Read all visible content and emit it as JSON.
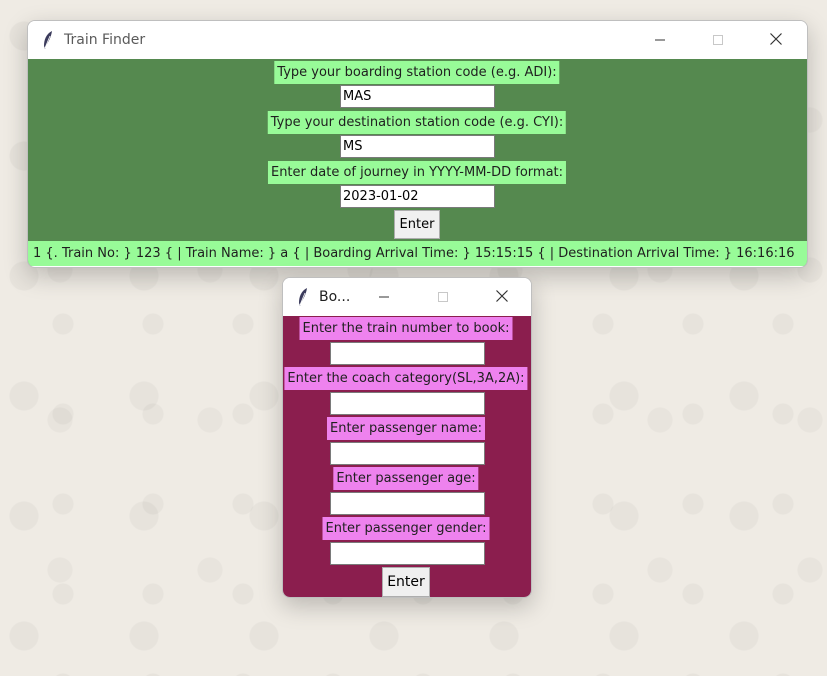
{
  "train_finder": {
    "title": "Train Finder",
    "boarding_label": "Type your boarding station code (e.g. ADI):",
    "boarding_value": "MAS",
    "destination_label": "Type your destination station code (e.g. CYI):",
    "destination_value": "MS",
    "date_label": "Enter date of journey in YYYY-MM-DD format:",
    "date_value": "2023-01-02",
    "enter_label": "Enter",
    "result_text": "1 {. Train No: } 123 { | Train Name: } a { | Boarding Arrival Time: } 15:15:15 { | Destination Arrival Time: } 16:16:16"
  },
  "booking": {
    "title": "Bo...",
    "train_number_label": "Enter the train number to book:",
    "train_number_value": "",
    "coach_label": "Enter the coach category(SL,3A,2A):",
    "coach_value": "",
    "name_label": "Enter passenger name:",
    "name_value": "",
    "age_label": "Enter passenger age:",
    "age_value": "",
    "gender_label": "Enter passenger gender:",
    "gender_value": "",
    "enter_label": "Enter"
  },
  "colors": {
    "train_finder_bg": "#55894f",
    "train_finder_label_bg": "#98fb98",
    "booking_bg": "#8b1e4e",
    "booking_label_bg": "#ee82ee"
  },
  "icons": {
    "app_icon": "feather-icon",
    "minimize": "minimize-icon",
    "maximize": "maximize-icon",
    "close": "close-icon"
  }
}
